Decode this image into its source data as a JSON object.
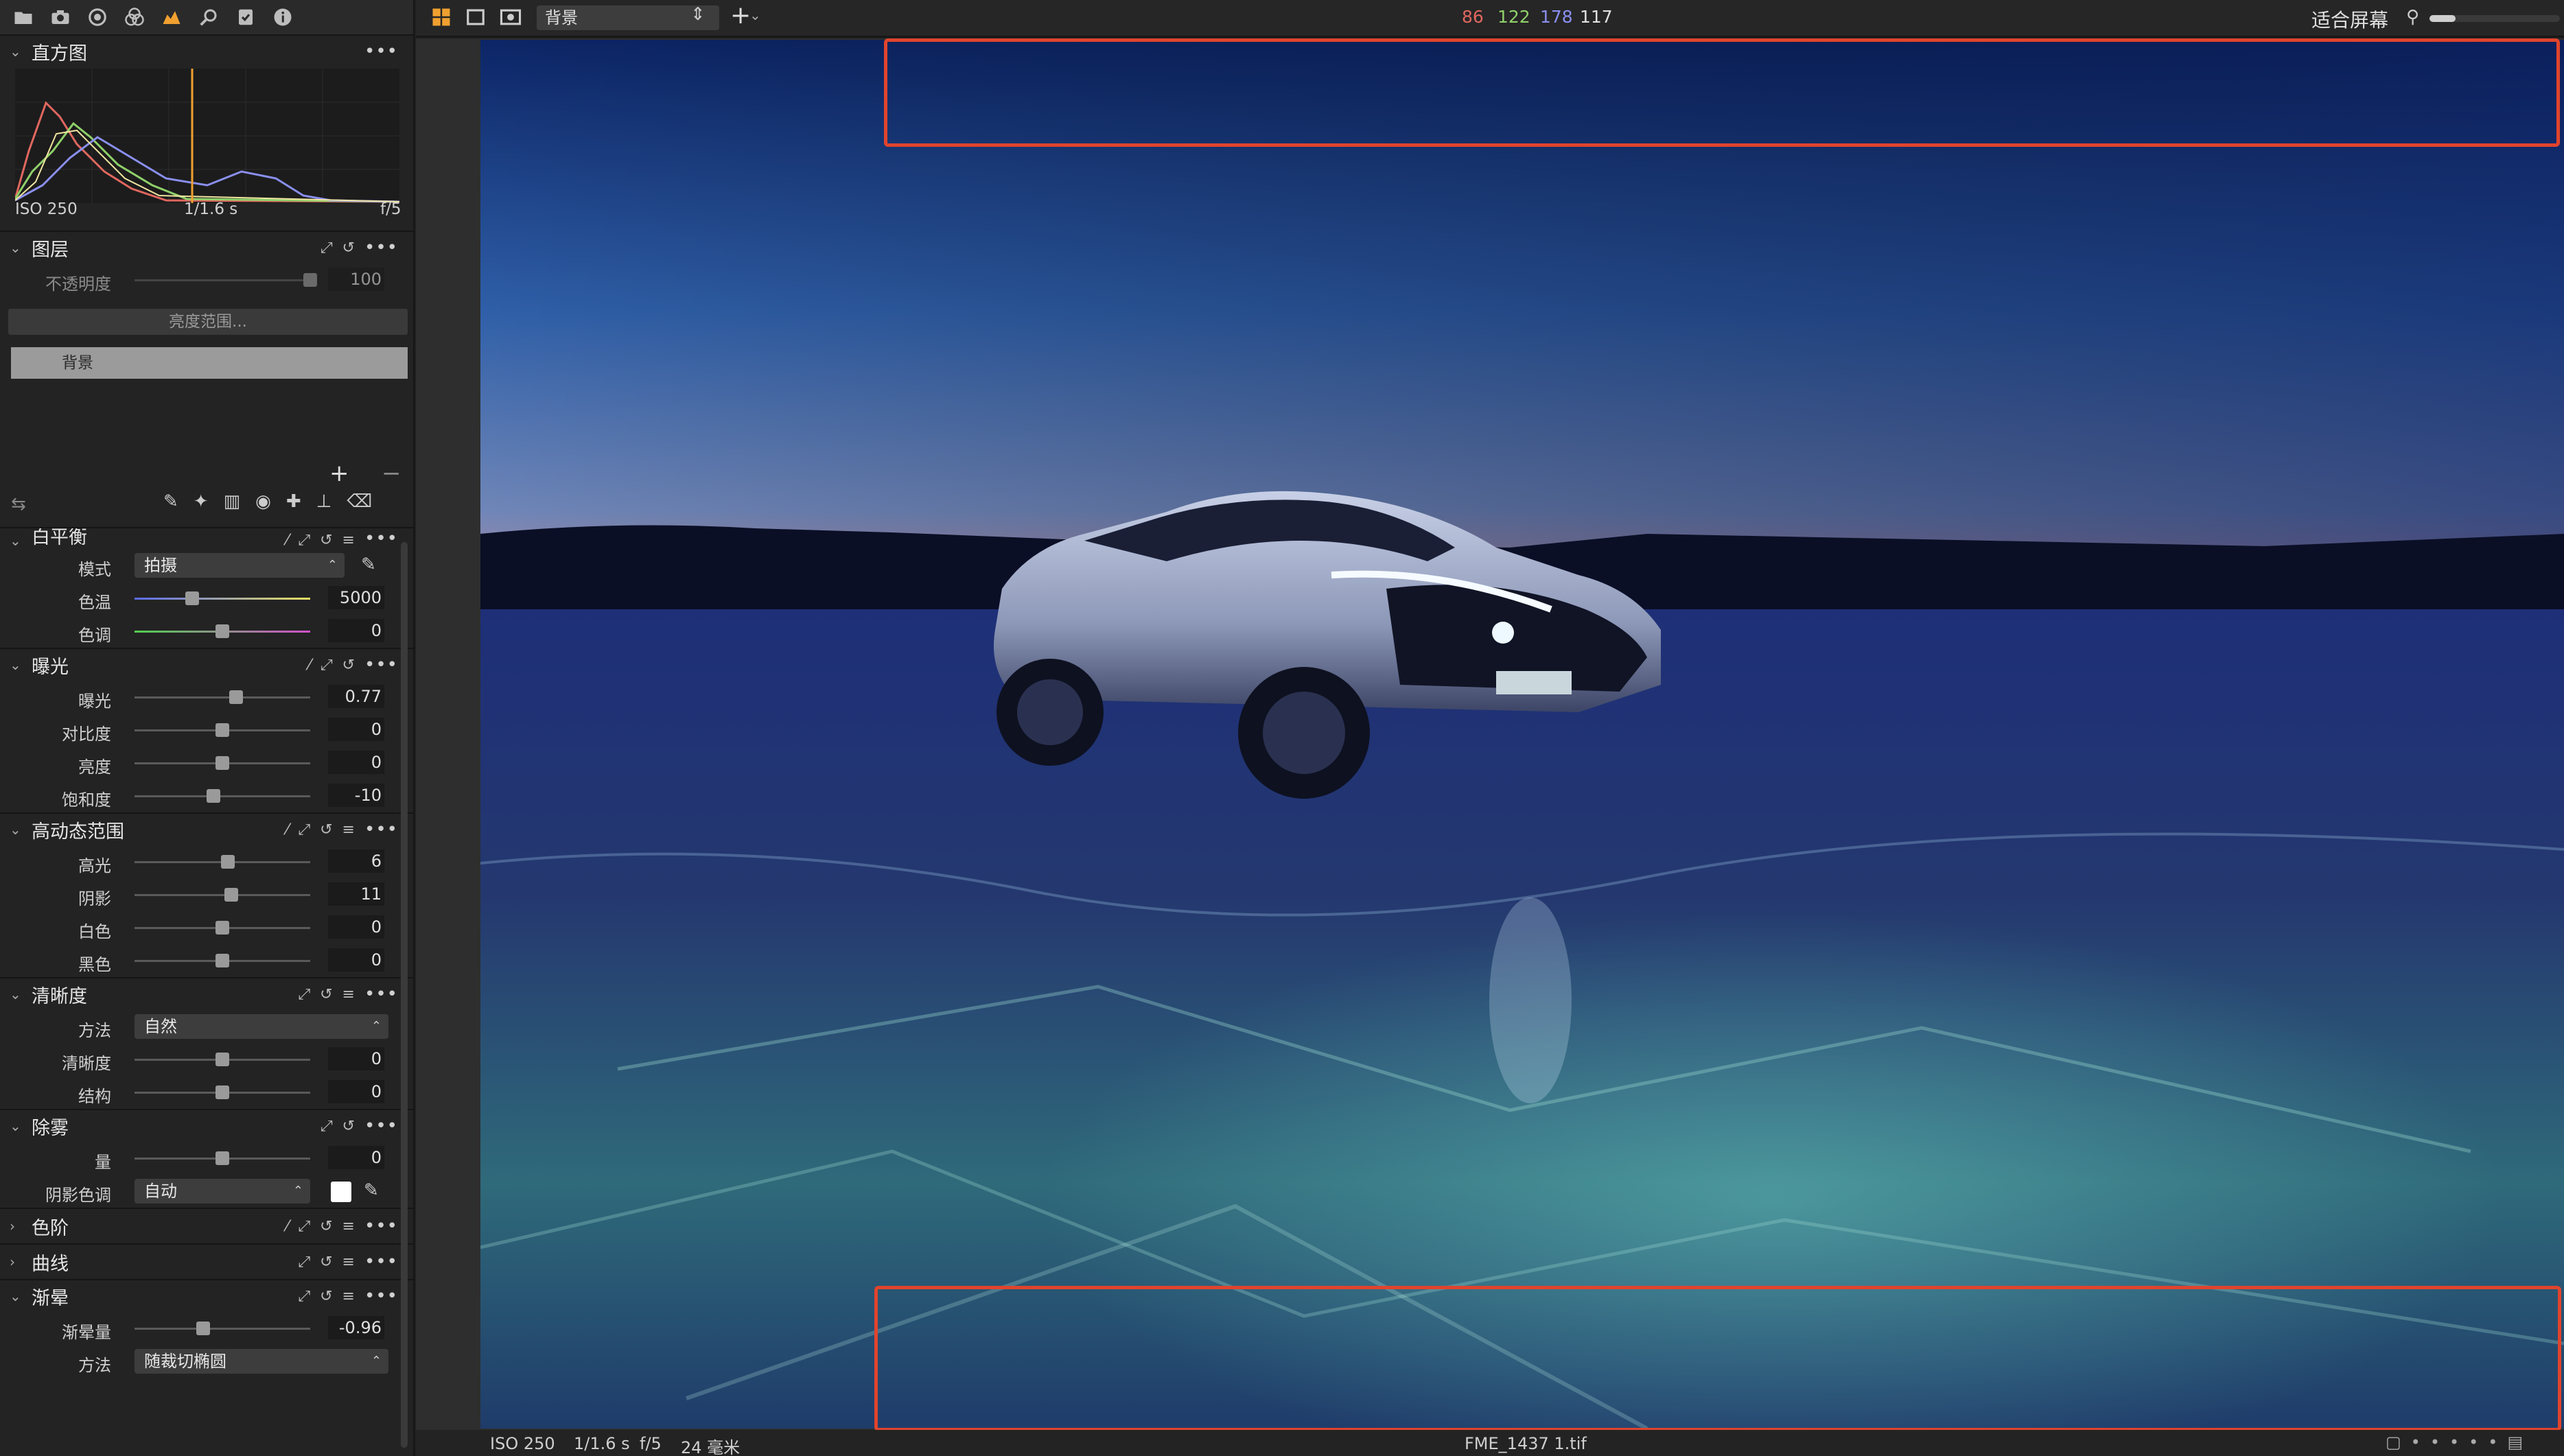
{
  "toolbar": {
    "icons": [
      "folder-icon",
      "camera-icon",
      "lens-icon",
      "color-icon",
      "exposure-icon",
      "search-icon",
      "metadata-icon",
      "info-icon"
    ]
  },
  "histogram": {
    "title": "直方图",
    "iso": "ISO 250",
    "shutter": "1/1.6 s",
    "aperture": "f/5"
  },
  "layers": {
    "title": "图层",
    "opacity_label": "不透明度",
    "opacity_value": "100",
    "luma_range": "亮度范围...",
    "background_layer": "背景"
  },
  "white_balance": {
    "title": "白平衡",
    "mode_label": "模式",
    "mode_value": "拍摄",
    "kelvin_label": "色温",
    "kelvin_value": "5000",
    "kelvin_pos": 0.33,
    "tint_label": "色调",
    "tint_value": "0",
    "tint_pos": 0.5
  },
  "exposure": {
    "title": "曝光",
    "items": [
      {
        "label": "曝光",
        "value": "0.77",
        "pos": 0.58
      },
      {
        "label": "对比度",
        "value": "0",
        "pos": 0.5
      },
      {
        "label": "亮度",
        "value": "0",
        "pos": 0.5
      },
      {
        "label": "饱和度",
        "value": "-10",
        "pos": 0.45
      }
    ]
  },
  "hdr": {
    "title": "高动态范围",
    "items": [
      {
        "label": "高光",
        "value": "6",
        "pos": 0.53
      },
      {
        "label": "阴影",
        "value": "11",
        "pos": 0.55
      },
      {
        "label": "白色",
        "value": "0",
        "pos": 0.5
      },
      {
        "label": "黑色",
        "value": "0",
        "pos": 0.5
      }
    ]
  },
  "clarity": {
    "title": "清晰度",
    "method_label": "方法",
    "method_value": "自然",
    "items": [
      {
        "label": "清晰度",
        "value": "0",
        "pos": 0.5
      },
      {
        "label": "结构",
        "value": "0",
        "pos": 0.5
      }
    ]
  },
  "dehaze": {
    "title": "除雾",
    "amount_label": "量",
    "amount_value": "0",
    "amount_pos": 0.5,
    "shadow_label": "阴影色调",
    "shadow_value": "自动"
  },
  "levels": {
    "title": "色阶"
  },
  "curve": {
    "title": "曲线"
  },
  "vignetting": {
    "title": "渐晕",
    "amount_label": "渐晕量",
    "amount_value": "-0.96",
    "amount_pos": 0.39,
    "method_label": "方法",
    "method_value": "随裁切椭圆"
  },
  "topbar": {
    "layer_select": "背景",
    "r": "86",
    "g": "122",
    "b": "178",
    "l": "117",
    "fit": "适合屏幕"
  },
  "status": {
    "iso": "ISO 250",
    "shutter": "1/1.6 s",
    "aperture": "f/5",
    "focal": "24 毫米",
    "filename": "FME_1437 1.tif"
  },
  "colors": {
    "accent": "#f0a030",
    "crop_box": "#e0442d",
    "r": "#e0675f",
    "g": "#8fd06a",
    "b": "#8a8ff0"
  }
}
